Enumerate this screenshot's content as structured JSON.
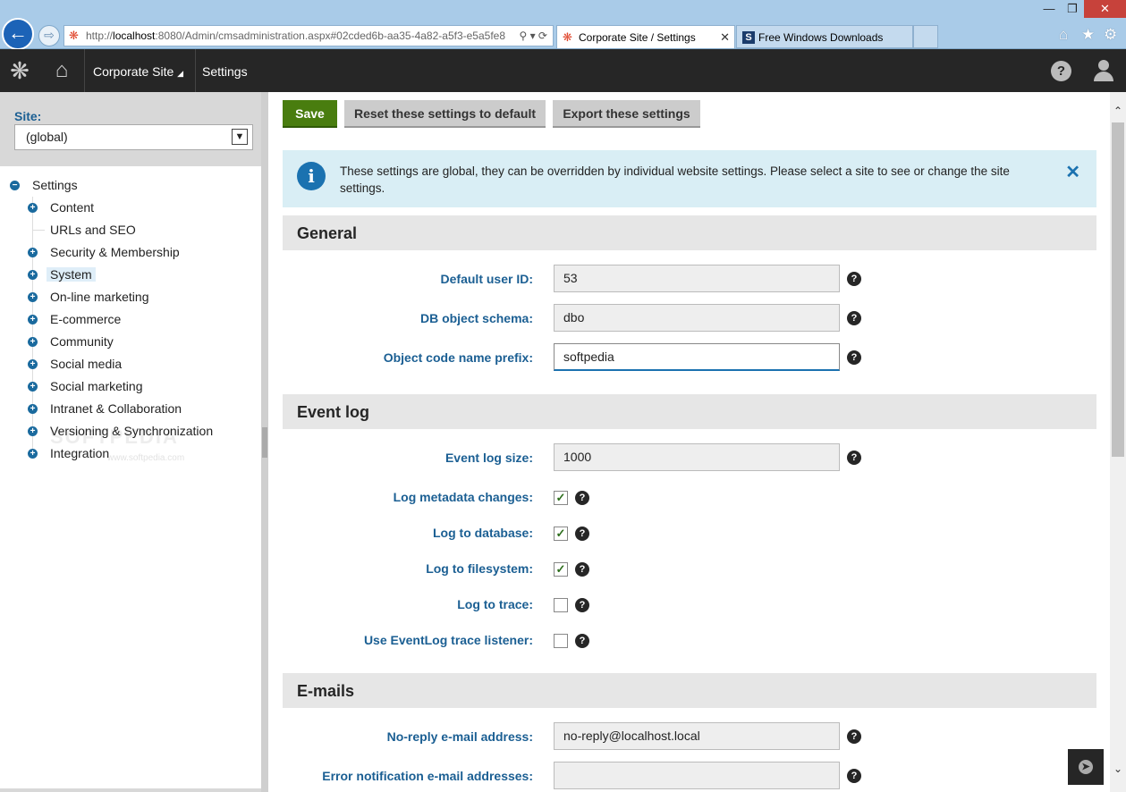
{
  "browser": {
    "url_prefix": "http://",
    "url_host": "localhost",
    "url_rest": ":8080/Admin/cmsadministration.aspx#02cded6b-aa35-4a82-a5f3-e5a5fe8",
    "tabs": [
      {
        "label": "Corporate Site / Settings",
        "active": true
      },
      {
        "label": "Free Windows Downloads",
        "active": false
      }
    ],
    "close_glyph": "✕",
    "window_controls": {
      "minimize": "—",
      "restore": "❐",
      "close": "✕"
    }
  },
  "header": {
    "logo_icon": "kentico-logo-icon",
    "home_icon": "home-icon",
    "site_menu_label": "Corporate Site",
    "app_label": "Settings",
    "help_glyph": "?"
  },
  "sidebar": {
    "site_label": "Site:",
    "site_value": "(global)",
    "tree_root": "Settings",
    "items": [
      {
        "label": "Content",
        "expandable": true
      },
      {
        "label": "URLs and SEO",
        "expandable": false
      },
      {
        "label": "Security & Membership",
        "expandable": true
      },
      {
        "label": "System",
        "expandable": true,
        "selected": true
      },
      {
        "label": "On-line marketing",
        "expandable": true
      },
      {
        "label": "E-commerce",
        "expandable": true
      },
      {
        "label": "Community",
        "expandable": true
      },
      {
        "label": "Social media",
        "expandable": true
      },
      {
        "label": "Social marketing",
        "expandable": true
      },
      {
        "label": "Intranet & Collaboration",
        "expandable": true
      },
      {
        "label": "Versioning & Synchronization",
        "expandable": true
      },
      {
        "label": "Integration",
        "expandable": true
      }
    ],
    "watermark": "SOFTPEDIA",
    "watermark_url": "www.softpedia.com"
  },
  "toolbar": {
    "save_label": "Save",
    "reset_label": "Reset these settings to default",
    "export_label": "Export these settings"
  },
  "info": {
    "text": "These settings are global, they can be overridden by individual website settings. Please select a site to see or change the site settings.",
    "icon_glyph": "i",
    "close_glyph": "✕"
  },
  "sections": {
    "general": {
      "title": "General",
      "fields": [
        {
          "label": "Default user ID:",
          "value": "53"
        },
        {
          "label": "DB object schema:",
          "value": "dbo"
        },
        {
          "label": "Object code name prefix:",
          "value": "softpedia"
        }
      ]
    },
    "eventlog": {
      "title": "Event log",
      "size_label": "Event log size:",
      "size_value": "1000",
      "checks": [
        {
          "label": "Log metadata changes:",
          "checked": true
        },
        {
          "label": "Log to database:",
          "checked": true
        },
        {
          "label": "Log to filesystem:",
          "checked": true
        },
        {
          "label": "Log to trace:",
          "checked": false
        },
        {
          "label": "Use EventLog trace listener:",
          "checked": false
        }
      ]
    },
    "emails": {
      "title": "E-mails",
      "fields": [
        {
          "label": "No-reply e-mail address:",
          "value": "no-reply@localhost.local"
        },
        {
          "label": "Error notification e-mail addresses:",
          "value": ""
        }
      ]
    }
  },
  "help_glyph": "?",
  "check_glyph": "✓",
  "colors": {
    "accent": "#1b5f93",
    "save": "#497d0f",
    "header_bg": "#262626",
    "info_bg": "#d9eef5"
  }
}
